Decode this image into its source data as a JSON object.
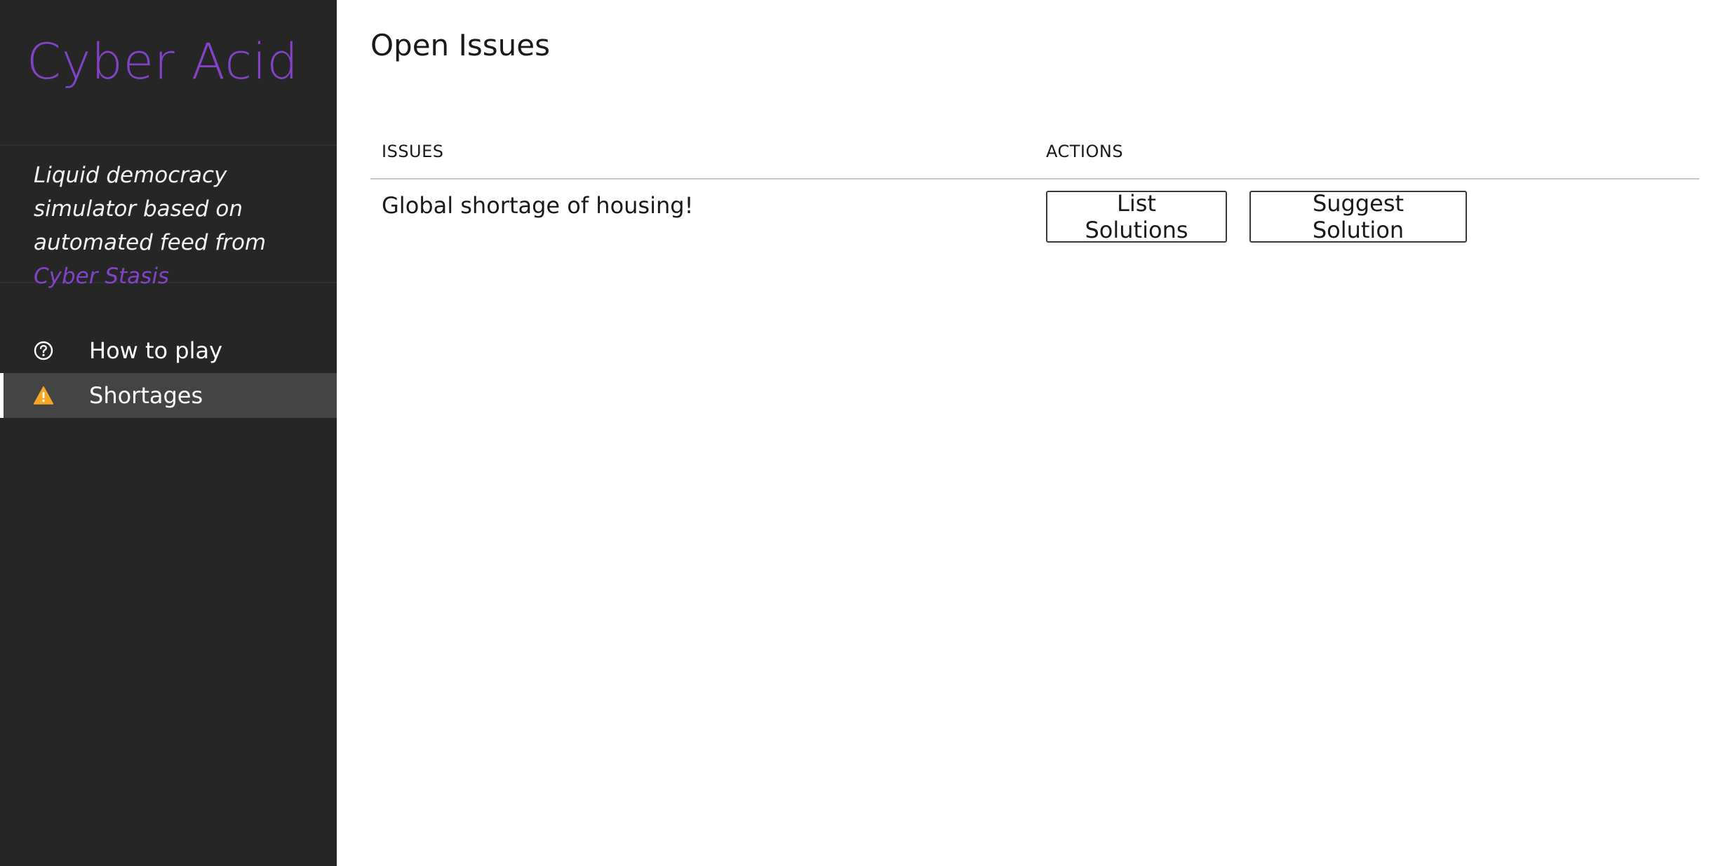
{
  "sidebar": {
    "brand": "Cyber Acid",
    "tagline_prefix": "Liquid democracy simulator based on automated feed from ",
    "tagline_link": "Cyber Stasis",
    "items": [
      {
        "label": "How to play",
        "icon": "question-circle-icon",
        "active": false
      },
      {
        "label": "Shortages",
        "icon": "warning-triangle-icon",
        "active": true
      }
    ],
    "accent_color": "#8243c7",
    "warning_color": "#f5a623"
  },
  "main": {
    "title": "Open Issues",
    "table": {
      "headers": {
        "issues": "ISSUES",
        "actions": "ACTIONS"
      },
      "rows": [
        {
          "issue": "Global shortage of housing!",
          "actions": [
            "List Solutions",
            "Suggest Solution"
          ]
        }
      ]
    }
  }
}
